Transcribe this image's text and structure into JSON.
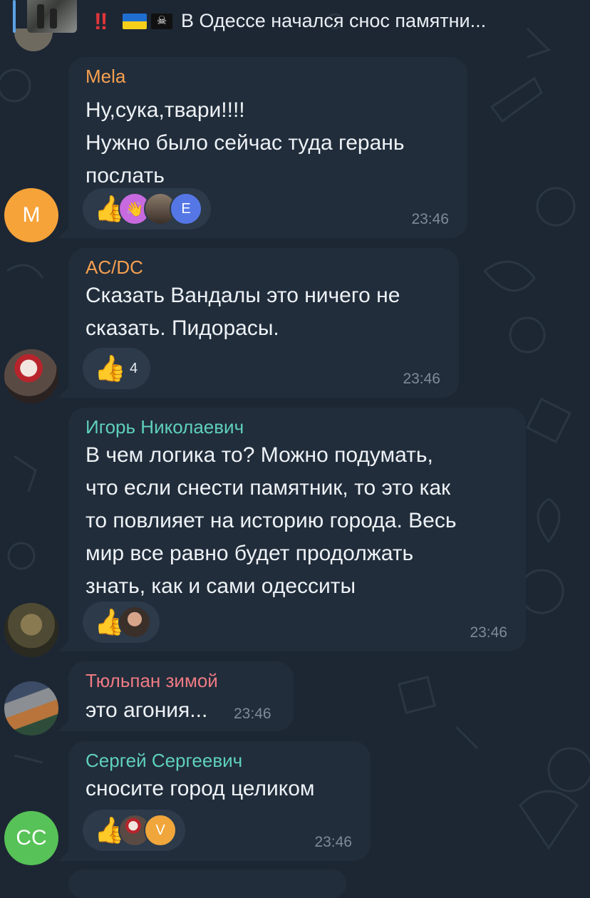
{
  "reply": {
    "text": "В Одессе начался снос памятни...",
    "bang_icon": "‼",
    "pirate_icon": "🏴‍☠️"
  },
  "messages": [
    {
      "sender": "Mela",
      "sender_color": "#f7a04f",
      "avatar_letter": "M",
      "avatar_color": "#f6a33a",
      "lines": [
        "Ну,сука,твари!!!!",
        "Нужно было сейчас туда герань",
        "послать"
      ],
      "time": "23:46",
      "reaction_icon": "👍",
      "reactor_icons": [
        "👋",
        "",
        "E"
      ]
    },
    {
      "sender": "AC/DC",
      "sender_color": "#f7a04f",
      "lines": [
        "Сказать Вандалы это ничего не",
        "сказать. Пидорасы."
      ],
      "time": "23:46",
      "reaction_icon": "👍",
      "reaction_count": "4"
    },
    {
      "sender": "Игорь Николаевич",
      "sender_color": "#5fd0bd",
      "lines": [
        "В чем логика то? Можно подумать,",
        "что если снести памятник, то это как",
        "то повлияет на историю города. Весь",
        "мир все равно будет продолжать",
        "знать, как и сами одесситы"
      ],
      "time": "23:46",
      "reaction_icon": "👍"
    },
    {
      "sender": "Тюльпан зимой",
      "sender_color": "#f07a83",
      "lines": [
        "это агония..."
      ],
      "time": "23:46"
    },
    {
      "sender": "Сергей Сергеевич",
      "sender_color": "#5fd0bd",
      "avatar_letter": "CC",
      "avatar_color": "#57c257",
      "lines": [
        "сносите город целиком"
      ],
      "time": "23:46",
      "reaction_icon": "👍",
      "reactor_icons": [
        "",
        "V"
      ]
    }
  ]
}
